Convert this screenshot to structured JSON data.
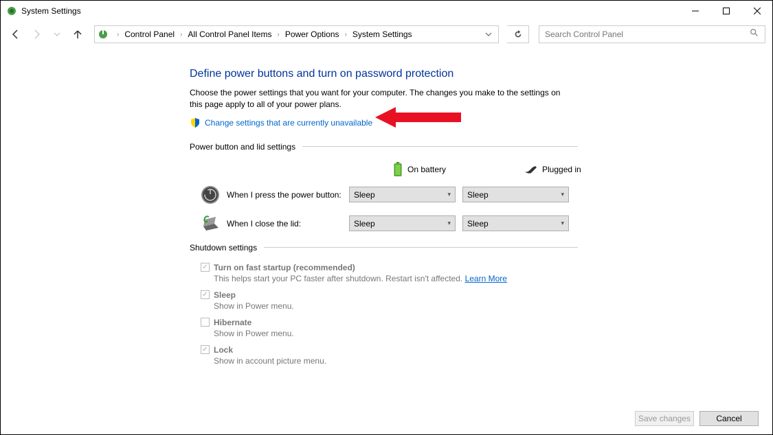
{
  "window": {
    "title": "System Settings"
  },
  "breadcrumb": {
    "items": [
      "Control Panel",
      "All Control Panel Items",
      "Power Options",
      "System Settings"
    ]
  },
  "search": {
    "placeholder": "Search Control Panel"
  },
  "main": {
    "heading": "Define power buttons and turn on password protection",
    "description": "Choose the power settings that you want for your computer. The changes you make to the settings on this page apply to all of your power plans.",
    "change_link": "Change settings that are currently unavailable"
  },
  "sections": {
    "power_button": {
      "label": "Power button and lid settings",
      "col_battery": "On battery",
      "col_plugged": "Plugged in",
      "rows": [
        {
          "label": "When I press the power button:",
          "battery": "Sleep",
          "plugged": "Sleep"
        },
        {
          "label": "When I close the lid:",
          "battery": "Sleep",
          "plugged": "Sleep"
        }
      ]
    },
    "shutdown": {
      "label": "Shutdown settings",
      "items": [
        {
          "checked": true,
          "title": "Turn on fast startup (recommended)",
          "desc": "This helps start your PC faster after shutdown. Restart isn't affected. ",
          "learn_more": "Learn More"
        },
        {
          "checked": true,
          "title": "Sleep",
          "desc": "Show in Power menu."
        },
        {
          "checked": false,
          "title": "Hibernate",
          "desc": "Show in Power menu."
        },
        {
          "checked": true,
          "title": "Lock",
          "desc": "Show in account picture menu."
        }
      ]
    }
  },
  "footer": {
    "save": "Save changes",
    "cancel": "Cancel"
  }
}
